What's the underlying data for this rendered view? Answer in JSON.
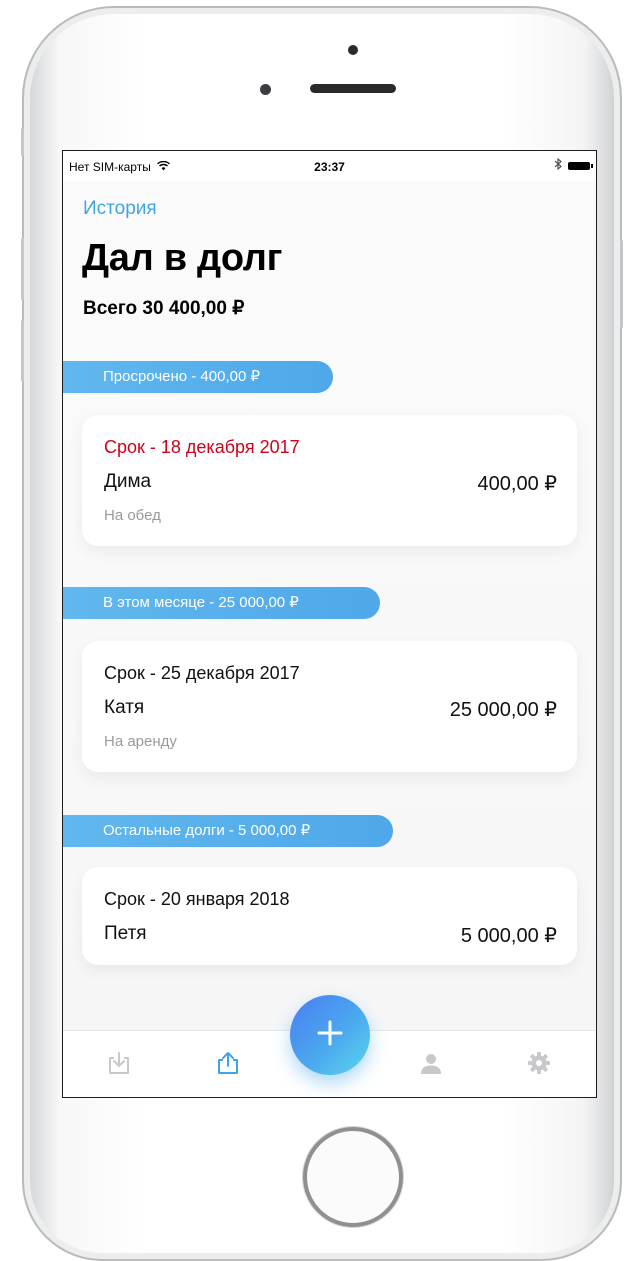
{
  "status_bar": {
    "carrier": "Нет SIM-карты",
    "time": "23:37",
    "icons": [
      "wifi-icon",
      "bluetooth-icon",
      "battery-icon"
    ]
  },
  "nav": {
    "back_label": "История"
  },
  "header": {
    "title": "Дал в долг",
    "total": "Всего 30 400,00 ₽"
  },
  "sections": [
    {
      "label": "Просрочено - 400,00 ₽",
      "debts": [
        {
          "due": "Срок - 18 декабря 2017",
          "overdue": true,
          "person": "Дима",
          "amount": "400,00 ₽",
          "note": "На обед"
        }
      ]
    },
    {
      "label": "В этом месяце - 25 000,00 ₽",
      "debts": [
        {
          "due": "Срок - 25 декабря 2017",
          "overdue": false,
          "person": "Катя",
          "amount": "25 000,00 ₽",
          "note": "На аренду"
        }
      ]
    },
    {
      "label": "Остальные долги - 5 000,00 ₽",
      "debts": [
        {
          "due": "Срок - 20 января 2018",
          "overdue": false,
          "person": "Петя",
          "amount": "5 000,00 ₽"
        }
      ]
    }
  ],
  "tab_bar": {
    "tabs": [
      {
        "icon": "download-tray-icon",
        "active": false
      },
      {
        "icon": "share-upload-icon",
        "active": true
      },
      {
        "icon": "plus-icon",
        "primary": true
      },
      {
        "icon": "person-icon",
        "active": false
      },
      {
        "icon": "gear-icon",
        "active": false
      }
    ]
  },
  "colors": {
    "accent": "#3fa6e3",
    "overdue": "#d0021b",
    "pill": "#55aeea",
    "fab_start": "#4a7df1",
    "fab_end": "#5cd6ee",
    "inactive_icon": "#c7c7cc"
  }
}
